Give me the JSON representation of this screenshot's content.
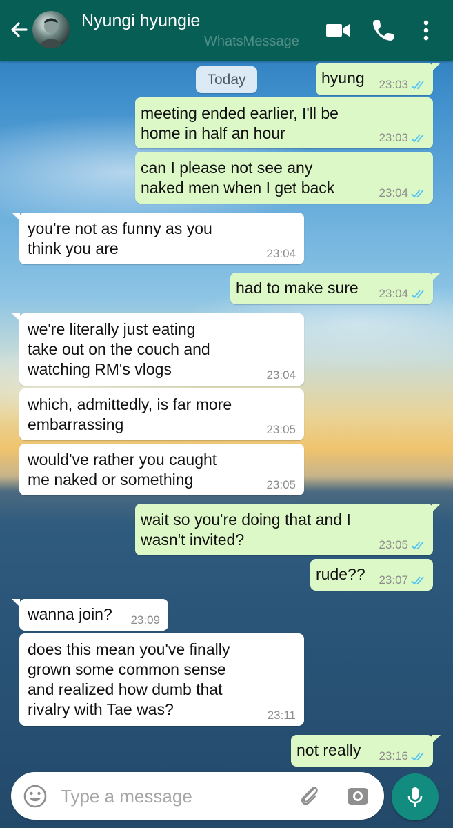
{
  "header": {
    "contact_name": "Nyungi hyungie",
    "watermark": "WhatsMessage",
    "icons": [
      "back-arrow-icon",
      "avatar",
      "video-call-icon",
      "phone-call-icon",
      "more-vertical-icon"
    ]
  },
  "date_chip": "Today",
  "messages": [
    {
      "dir": "out",
      "text": "hyung",
      "time": "23:03",
      "status": "read"
    },
    {
      "dir": "out",
      "text": "meeting ended earlier, I'll be\nhome in half an hour",
      "time": "23:03",
      "status": "read"
    },
    {
      "dir": "out",
      "text": "can I please not see any\nnaked men when I get back",
      "time": "23:04",
      "status": "read"
    },
    {
      "dir": "in",
      "text": "you're not as funny as you\nthink you are",
      "time": "23:04"
    },
    {
      "dir": "out",
      "text": "had to make sure",
      "time": "23:04",
      "status": "read"
    },
    {
      "dir": "in",
      "text": "we're literally just eating\ntake out on the couch and\nwatching RM's vlogs",
      "time": "23:04"
    },
    {
      "dir": "in",
      "text": "which, admittedly, is far more\nembarrassing",
      "time": "23:05"
    },
    {
      "dir": "in",
      "text": "would've rather you caught\nme naked or something",
      "time": "23:05"
    },
    {
      "dir": "out",
      "text": "wait so you're doing that and I\nwasn't invited?",
      "time": "23:05",
      "status": "read"
    },
    {
      "dir": "out",
      "text": "rude??",
      "time": "23:07",
      "status": "read"
    },
    {
      "dir": "in",
      "text": "wanna join?",
      "time": "23:09"
    },
    {
      "dir": "in",
      "text": "does this mean you've finally\ngrown some common sense\nand realized how dumb that\nrivalry with Tae was?",
      "time": "23:11"
    },
    {
      "dir": "out",
      "text": "not really",
      "time": "23:16",
      "status": "read"
    }
  ],
  "composer": {
    "placeholder": "Type a message",
    "value": ""
  },
  "colors": {
    "header": "#075e54",
    "outgoing_bubble": "#dcf8c6",
    "incoming_bubble": "#ffffff",
    "read_ticks": "#4fc3f7",
    "mic_button": "#128c7e"
  }
}
